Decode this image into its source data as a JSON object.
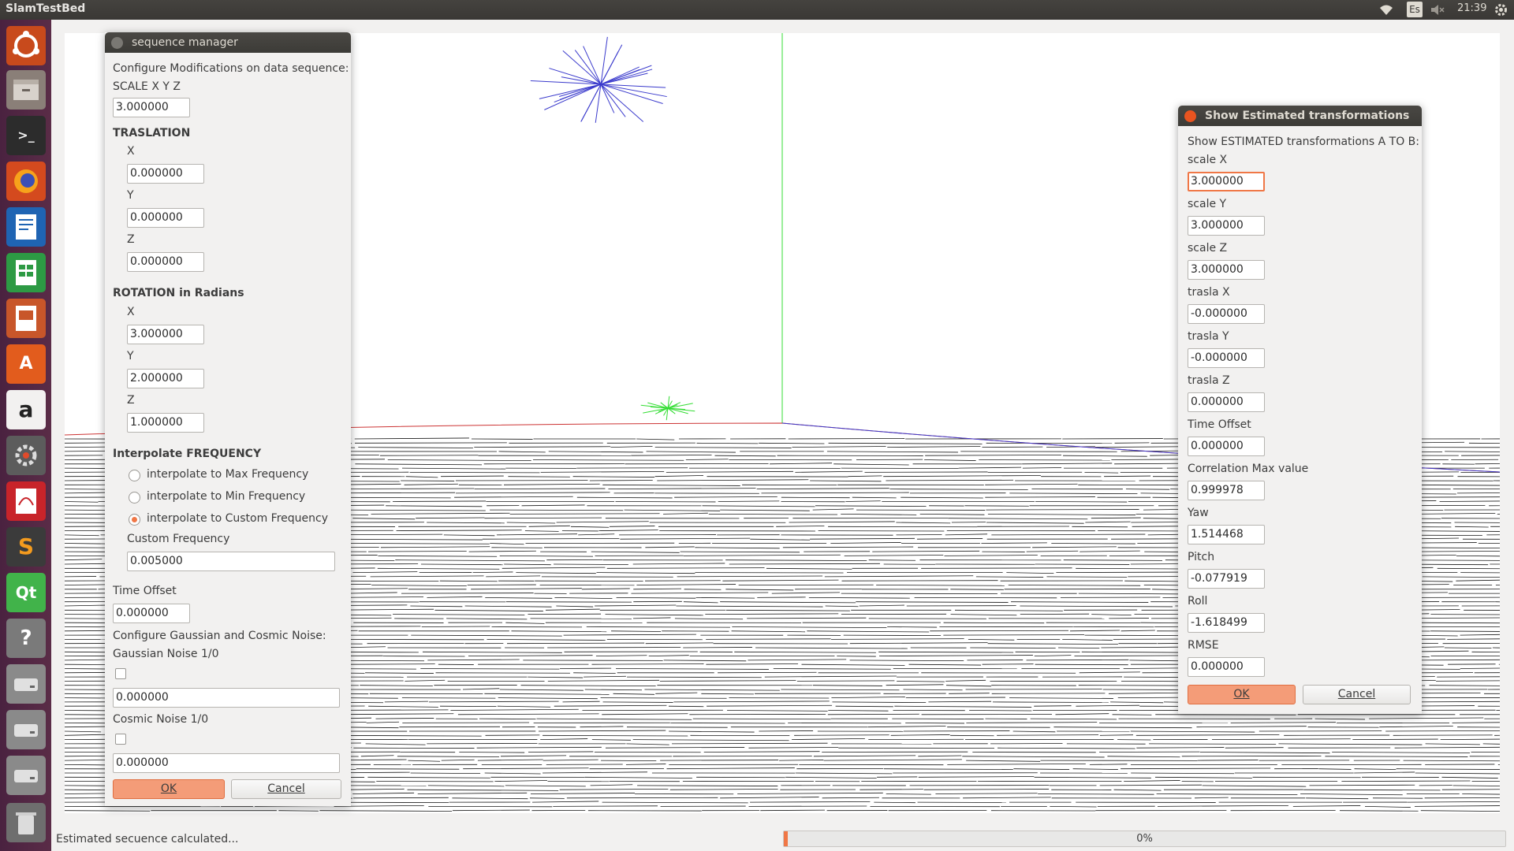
{
  "topbar": {
    "app_title": "SlamTestBed",
    "keyboard_layout": "Es",
    "clock": "21:39"
  },
  "launcher": {
    "items": [
      "ubuntu-dash",
      "files",
      "terminal",
      "firefox",
      "writer",
      "calc",
      "impress",
      "software-center",
      "amazon",
      "system-settings",
      "document-viewer",
      "sublime-text",
      "qt-creator",
      "help",
      "disk-drive-1",
      "disk-drive-2",
      "disk-drive-3",
      "trash"
    ]
  },
  "sequence_manager": {
    "title": "sequence manager",
    "header": "Configure Modifications on data sequence:",
    "scale_label": "SCALE X Y Z",
    "scale_value": "3.000000",
    "translation_heading": "TRASLATION",
    "trans_x_label": "X",
    "trans_x_value": "0.000000",
    "trans_y_label": "Y",
    "trans_y_value": "0.000000",
    "trans_z_label": "Z",
    "trans_z_value": "0.000000",
    "rotation_heading": "ROTATION in Radians",
    "rot_x_label": "X",
    "rot_x_value": "3.000000",
    "rot_y_label": "Y",
    "rot_y_value": "2.000000",
    "rot_z_label": "Z",
    "rot_z_value": "1.000000",
    "interp_heading": "Interpolate FREQUENCY",
    "radio_max": "interpolate to Max Frequency",
    "radio_min": "interpolate to Min Frequency",
    "radio_custom": "interpolate to Custom Frequency",
    "selected_radio": "custom",
    "custom_freq_label": "Custom Frequency",
    "custom_freq_value": "0.005000",
    "time_offset_label": "Time Offset",
    "time_offset_value": "0.000000",
    "noise_header": "Configure Gaussian and Cosmic Noise:",
    "gaussian_label": "Gaussian Noise 1/0",
    "gaussian_checked": false,
    "gaussian_value": "0.000000",
    "cosmic_label": "Cosmic Noise 1/0",
    "cosmic_checked": false,
    "cosmic_value": "0.000000",
    "ok_label": "OK",
    "cancel_label": "Cancel"
  },
  "estimated": {
    "title": "Show Estimated transformations",
    "header": "Show ESTIMATED transformations A TO B:",
    "fields": [
      {
        "label": "scale X",
        "value": "3.000000"
      },
      {
        "label": "scale Y",
        "value": "3.000000"
      },
      {
        "label": "scale Z",
        "value": "3.000000"
      },
      {
        "label": "trasla X",
        "value": "-0.000000"
      },
      {
        "label": "trasla Y",
        "value": "-0.000000"
      },
      {
        "label": "trasla Z",
        "value": "0.000000"
      },
      {
        "label": "Time Offset",
        "value": "0.000000"
      },
      {
        "label": "Correlation Max value",
        "value": "0.999978"
      },
      {
        "label": "Yaw",
        "value": "1.514468"
      },
      {
        "label": "Pitch",
        "value": "-0.077919"
      },
      {
        "label": "Roll",
        "value": "-1.618499"
      },
      {
        "label": "RMSE",
        "value": "0.000000"
      }
    ],
    "ok_label": "OK",
    "cancel_label": "Cancel"
  },
  "statusbar": {
    "message": "Estimated secuence calculated...",
    "progress_text": "0%",
    "progress_fraction": 0.005
  },
  "colors": {
    "accent": "#f07746",
    "blue_curve": "#3a3acc",
    "green_curve": "#33dd33",
    "red_curve": "#cc3333"
  }
}
